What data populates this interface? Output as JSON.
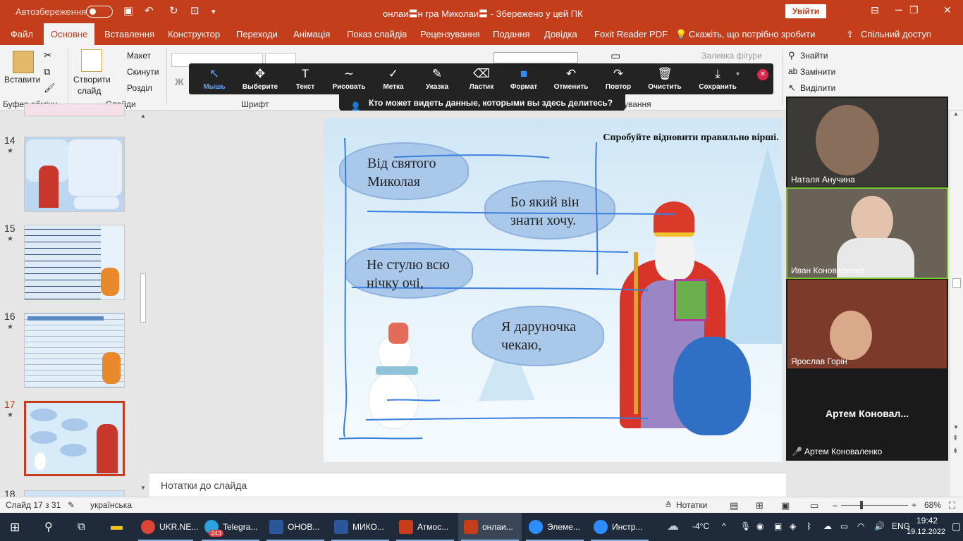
{
  "titlebar": {
    "autosave": "Автозбереження",
    "title": "онлаи〓н гра Миколаи〓  -  Збережено у цей ПК",
    "signin": "Увійти"
  },
  "tabs": [
    "Файл",
    "Основне",
    "Вставлення",
    "Конструктор",
    "Переходи",
    "Анімація",
    "Показ слайдів",
    "Рецензування",
    "Подання",
    "Довідка",
    "Foxit Reader PDF",
    "Скажіть, що потрібно зробити",
    "Спільний доступ"
  ],
  "ribbon": {
    "paste": "Вставити",
    "create_slide_1": "Створити",
    "create_slide_2": "слайд",
    "layout": "Макет",
    "reset": "Скинути",
    "section": "Розділ",
    "shape_fill": "Заливка фігури",
    "find": "Знайти",
    "replace": "Замінити",
    "select": "Виділити",
    "groups": {
      "clipboard": "Буфер обміну",
      "slides": "Слайди",
      "font": "Шрифт",
      "editing_partial": "ування"
    }
  },
  "zoom_toolbar": {
    "items": [
      {
        "label": "Мышь",
        "icon": "↖"
      },
      {
        "label": "Выберите",
        "icon": "✥"
      },
      {
        "label": "Текст",
        "icon": "T"
      },
      {
        "label": "Рисовать",
        "icon": "∼"
      },
      {
        "label": "Метка",
        "icon": "✓"
      },
      {
        "label": "Указка",
        "icon": "✎"
      },
      {
        "label": "Ластик",
        "icon": "⌫"
      },
      {
        "label": "Формат",
        "icon": "■"
      },
      {
        "label": "Отменить",
        "icon": "↶"
      },
      {
        "label": "Повтор",
        "icon": "↷"
      },
      {
        "label": "Очистить",
        "icon": "🗑"
      },
      {
        "label": "Сохранить",
        "icon": "⤓"
      }
    ],
    "share_notice": "Кто может видеть данные, которыми вы здесь делитесь?"
  },
  "thumbnails": [
    {
      "num": "14"
    },
    {
      "num": "15"
    },
    {
      "num": "16"
    },
    {
      "num": "17"
    },
    {
      "num": "18"
    }
  ],
  "slide": {
    "title": "Спробуйте відновити правильно вірші.",
    "clouds": [
      {
        "text1": "Від святого",
        "text2": "Миколая"
      },
      {
        "text1": "Бо який він",
        "text2": "знати хочу."
      },
      {
        "text1": "Не стулю всю",
        "text2": "нічку очі,"
      },
      {
        "text1": "Я дарунoчка",
        "text2": "чекаю,"
      }
    ]
  },
  "notes_placeholder": "Нотатки до слайда",
  "participants": [
    {
      "name": "Наталя Анучина"
    },
    {
      "name": "Иван Коноваленко"
    },
    {
      "name": "Ярослав Горін"
    },
    {
      "name": "Артем  Коновал...",
      "footer": "Артем Коноваленко"
    }
  ],
  "statusbar": {
    "slide_info": "Слайд 17 з 31",
    "language": "українська",
    "notes": "Нотатки",
    "zoom": "68%"
  },
  "taskbar": {
    "apps": [
      {
        "label": "UKR.NE...",
        "color": "#db4437"
      },
      {
        "label": "Telegra...",
        "color": "#2aa3e0"
      },
      {
        "label": "ОНОВ...",
        "color": "#2b579a"
      },
      {
        "label": "МИКО...",
        "color": "#2b579a"
      },
      {
        "label": "Атмос...",
        "color": "#c43e1c"
      },
      {
        "label": "онлаи...",
        "color": "#c43e1c"
      },
      {
        "label": "Элеме...",
        "color": "#2d8cff"
      },
      {
        "label": "Инстр...",
        "color": "#2d8cff"
      }
    ],
    "telegram_badge": "243",
    "temperature": "-4°C",
    "lang": "ENG",
    "time": "19:42",
    "date": "19.12.2022"
  }
}
